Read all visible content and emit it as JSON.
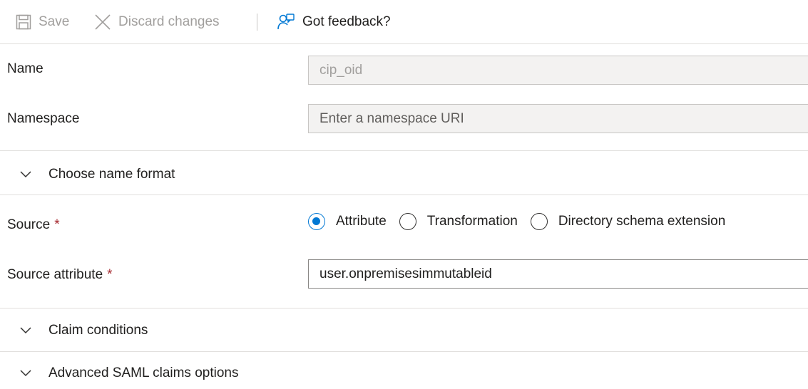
{
  "toolbar": {
    "save_label": "Save",
    "discard_label": "Discard changes",
    "feedback_label": "Got feedback?"
  },
  "form": {
    "name": {
      "label": "Name",
      "value": "cip_oid"
    },
    "namespace": {
      "label": "Namespace",
      "placeholder": "Enter a namespace URI"
    },
    "source": {
      "label": "Source",
      "required_marker": "*",
      "options": [
        {
          "label": "Attribute",
          "selected": true
        },
        {
          "label": "Transformation",
          "selected": false
        },
        {
          "label": "Directory schema extension",
          "selected": false
        }
      ]
    },
    "source_attribute": {
      "label": "Source attribute",
      "required_marker": "*",
      "value": "user.onpremisesimmutableid"
    }
  },
  "sections": {
    "name_format": "Choose name format",
    "claim_conditions": "Claim conditions",
    "advanced_saml": "Advanced SAML claims options"
  },
  "colors": {
    "accent": "#0078d4",
    "required": "#a4262c",
    "disabled_text": "#a19f9d"
  },
  "icons": {
    "save": "save-icon",
    "discard": "close-icon",
    "feedback": "feedback-icon",
    "expand": "chevron-down-icon"
  }
}
